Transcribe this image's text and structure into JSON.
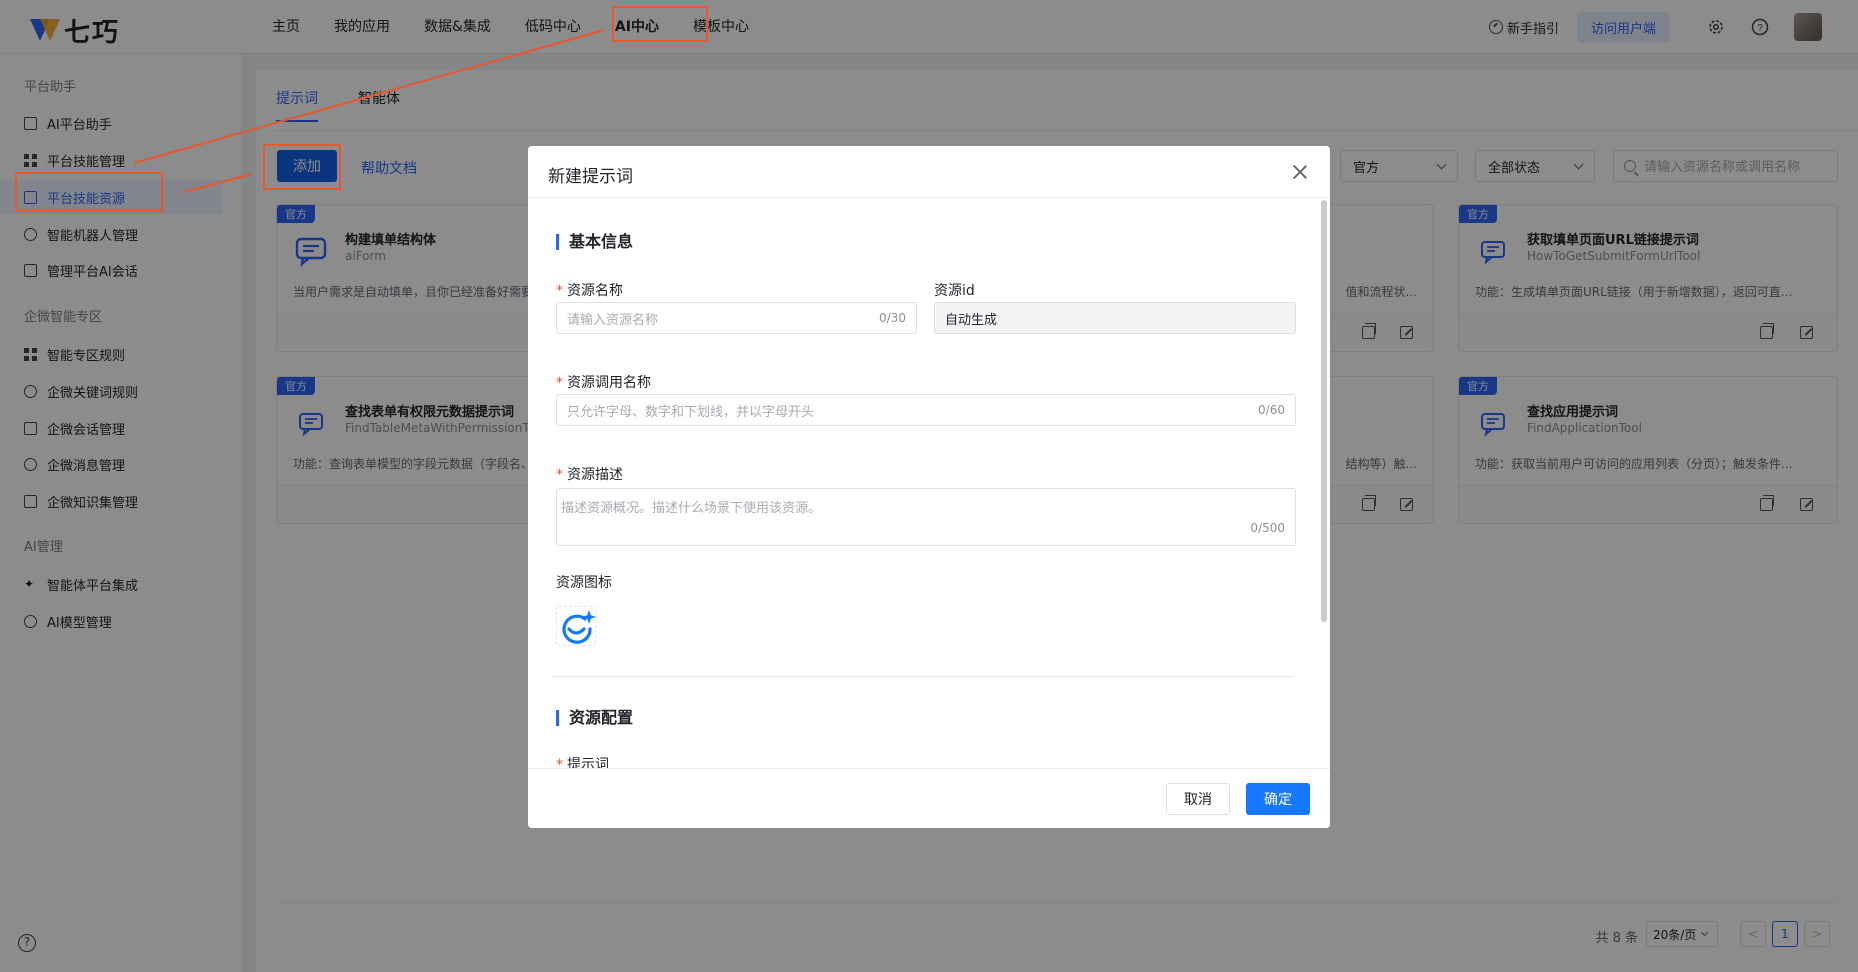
{
  "app": {
    "logo_text": "七巧"
  },
  "nav": {
    "items": [
      "主页",
      "我的应用",
      "数据&集成",
      "低码中心",
      "AI中心",
      "模板中心"
    ],
    "active_index": 4
  },
  "topbar": {
    "guide_label": "新手指引",
    "visit_label": "访问用户端"
  },
  "sidebar": {
    "groups": [
      {
        "title": "平台助手",
        "items": [
          "AI平台助手",
          "平台技能管理",
          "平台技能资源"
        ]
      },
      {
        "title": "",
        "items": [
          "智能机器人管理",
          "管理平台AI会话"
        ]
      },
      {
        "title": "企微智能专区",
        "items": [
          "智能专区规则",
          "企微关键词规则",
          "企微会话管理",
          "企微消息管理",
          "企微知识集管理"
        ]
      },
      {
        "title": "AI管理",
        "items": [
          "智能体平台集成",
          "AI模型管理"
        ]
      }
    ],
    "active_item": "平台技能资源"
  },
  "main": {
    "tabs": [
      "提示词",
      "智能体"
    ],
    "active_tab": 0,
    "add_label": "添加",
    "help_doc_label": "帮助文档",
    "filter_source": "官方",
    "filter_status": "全部状态",
    "search_placeholder": "请输入资源名称或调用名称",
    "cards": [
      {
        "badge": "官方",
        "title": "构建填单结构体",
        "sub": "aiForm",
        "desc": "当用户需求是自动填单，且你已经准备好需要"
      },
      {
        "badge": "官方",
        "title": "获取填单页面URL链接提示词",
        "sub": "HowToGetSubmitFormUrlTool",
        "desc": "功能：生成填单页面URL链接（用于新增数据），返回可直..."
      },
      {
        "badge": "官方",
        "title": "查找表单有权限元数据提示词",
        "sub": "FindTableMetaWithPermissionTo",
        "desc": "功能：查询表单模型的字段元数据（字段名、"
      },
      {
        "badge": "官方",
        "title": "查找应用提示词",
        "sub": "FindApplicationTool",
        "desc": "功能：获取当前用户可访问的应用列表（分页）；触发条件..."
      }
    ],
    "partial_texts": [
      "值和流程状...",
      "结构等）触..."
    ],
    "pager": {
      "total": "共 8 条",
      "page_size": "20条/页",
      "current": "1",
      "prev": "<",
      "next": ">"
    }
  },
  "modal": {
    "title": "新建提示词",
    "section_basic": "基本信息",
    "name_label": "资源名称",
    "name_placeholder": "请输入资源名称",
    "name_count": "0/30",
    "id_label": "资源id",
    "id_value": "自动生成",
    "call_label": "资源调用名称",
    "call_placeholder": "只允许字母、数字和下划线，并以字母开头",
    "call_count": "0/60",
    "desc_label": "资源描述",
    "desc_placeholder": "描述资源概况。描述什么场景下使用该资源。",
    "desc_count": "0/500",
    "icon_label": "资源图标",
    "section_config": "资源配置",
    "prompt_label": "提示词",
    "cancel_label": "取消",
    "ok_label": "确定"
  },
  "colors": {
    "accent": "#2f65f6",
    "primary_button": "#1677ff",
    "annotation": "#e8572d"
  }
}
